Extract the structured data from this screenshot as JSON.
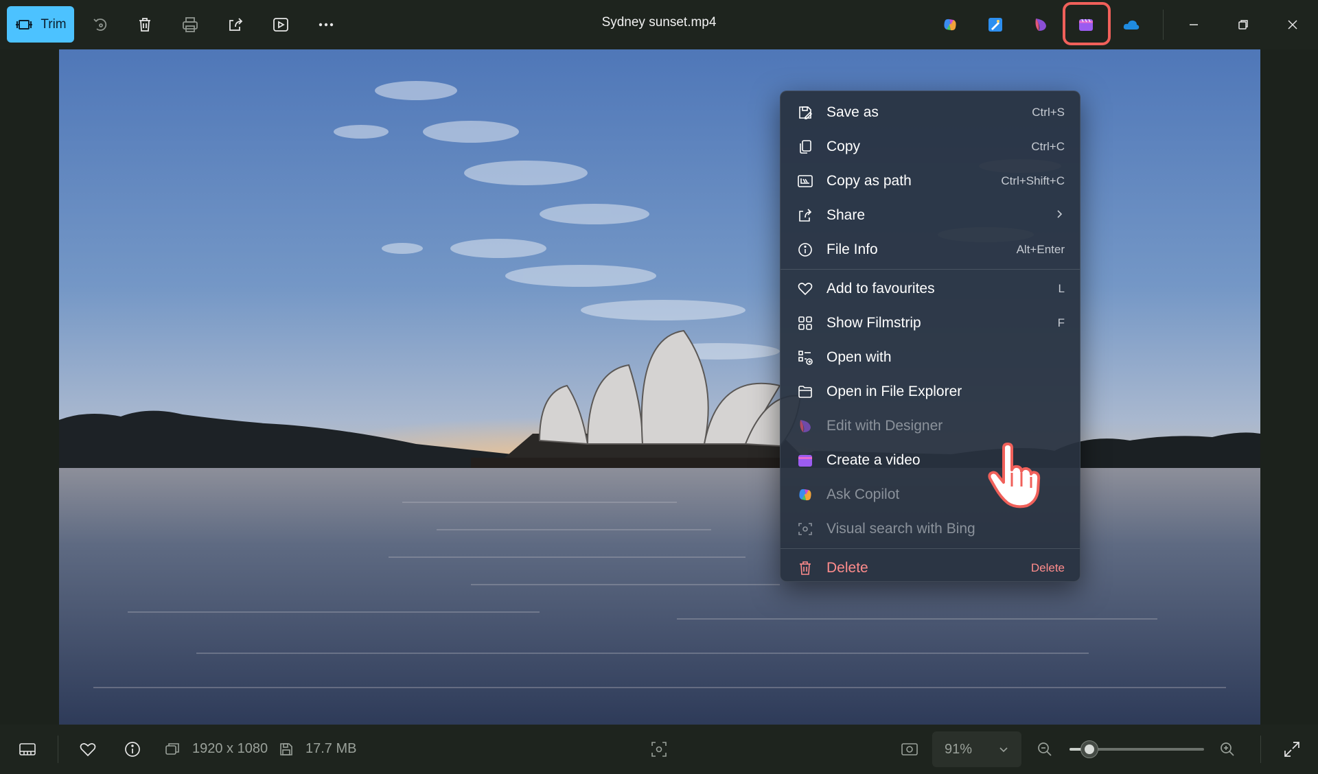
{
  "toolbar": {
    "trim_label": "Trim",
    "title": "Sydney sunset.mp4"
  },
  "menu": {
    "items": [
      {
        "label": "Save as",
        "shortcut": "Ctrl+S",
        "icon": "save-as-icon"
      },
      {
        "label": "Copy",
        "shortcut": "Ctrl+C",
        "icon": "copy-icon"
      },
      {
        "label": "Copy as path",
        "shortcut": "Ctrl+Shift+C",
        "icon": "copy-path-icon"
      },
      {
        "label": "Share",
        "shortcut": "",
        "icon": "share-icon"
      },
      {
        "label": "File Info",
        "shortcut": "Alt+Enter",
        "icon": "info-icon"
      },
      {
        "label": "Add to favourites",
        "shortcut": "L",
        "icon": "heart-icon"
      },
      {
        "label": "Show Filmstrip",
        "shortcut": "F",
        "icon": "grid-icon"
      },
      {
        "label": "Open with",
        "shortcut": "",
        "icon": "open-with-icon"
      },
      {
        "label": "Open in File Explorer",
        "shortcut": "",
        "icon": "folder-icon"
      },
      {
        "label": "Edit with Designer",
        "shortcut": "",
        "icon": "designer-icon"
      },
      {
        "label": "Create a video",
        "shortcut": "",
        "icon": "clipchamp-icon"
      },
      {
        "label": "Ask Copilot",
        "shortcut": "",
        "icon": "copilot-icon"
      },
      {
        "label": "Visual search with Bing",
        "shortcut": "",
        "icon": "visual-search-icon"
      },
      {
        "label": "Delete",
        "shortcut": "Delete",
        "icon": "trash-icon"
      }
    ]
  },
  "statusbar": {
    "dimensions": "1920 x 1080",
    "file_size": "17.7 MB",
    "zoom": "91%",
    "zoom_slider_fraction": 0.15
  },
  "colors": {
    "accent": "#4cc2ff",
    "highlight": "#f0605a",
    "danger": "#ff8c8c"
  }
}
